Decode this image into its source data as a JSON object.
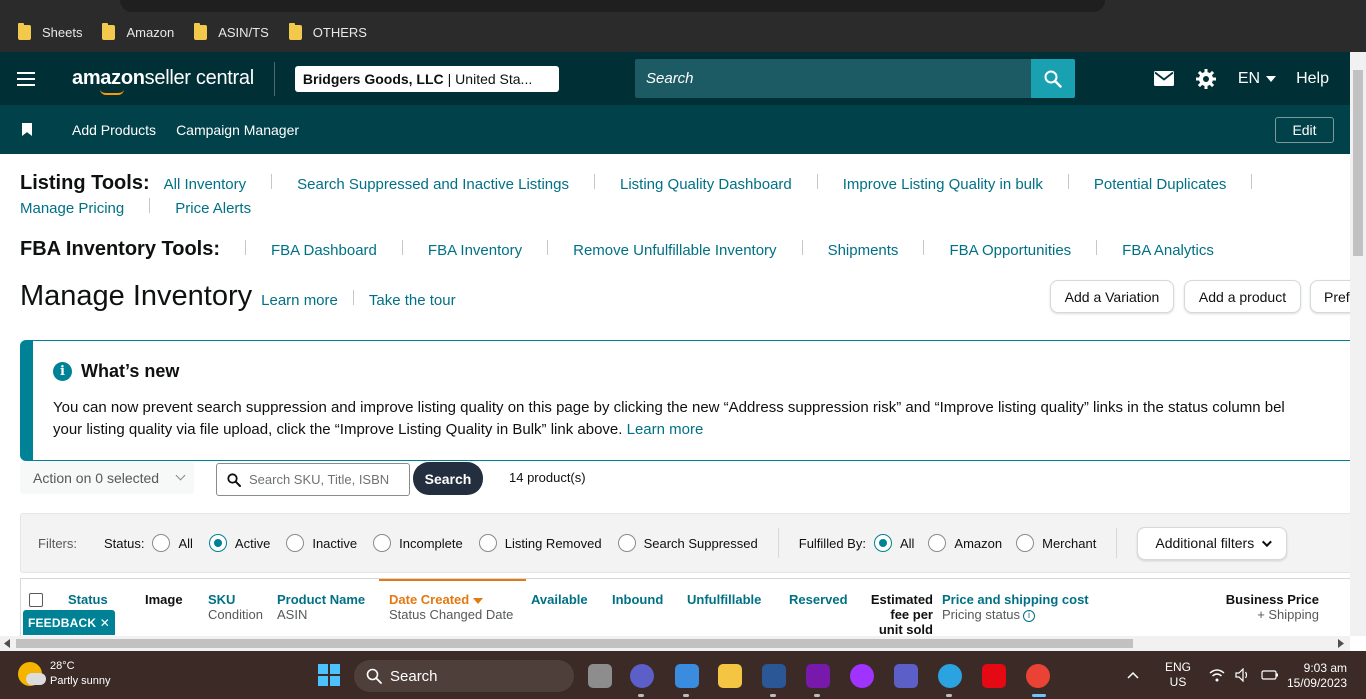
{
  "bookmarks": [
    "Sheets",
    "Amazon",
    "ASIN/TS",
    "OTHERS"
  ],
  "header": {
    "logo_bold": "amazon",
    "logo_rest": " seller central",
    "account_name": "Bridgers Goods, LLC",
    "account_region": "| United Sta...",
    "search_placeholder": "Search",
    "language": "EN",
    "help": "Help"
  },
  "nav": {
    "links": [
      "Add Products",
      "Campaign Manager"
    ],
    "edit": "Edit"
  },
  "listing_tools": {
    "label": "Listing Tools:",
    "links": [
      "All Inventory",
      "Search Suppressed and Inactive Listings",
      "Listing Quality Dashboard",
      "Improve Listing Quality in bulk",
      "Potential Duplicates",
      "Manage Pricing",
      "Price Alerts"
    ]
  },
  "fba_tools": {
    "label": "FBA Inventory Tools:",
    "links": [
      "FBA Dashboard",
      "FBA Inventory",
      "Remove Unfulfillable Inventory",
      "Shipments",
      "FBA Opportunities",
      "FBA Analytics"
    ]
  },
  "page": {
    "title": "Manage Inventory",
    "learn_more": "Learn more",
    "take_tour": "Take the tour",
    "buttons": [
      "Add a Variation",
      "Add a product",
      "Pref"
    ]
  },
  "whats_new": {
    "title": "What’s new",
    "line1": "You can now prevent search suppression and improve listing quality on this page by clicking the new “Address suppression risk” and “Improve listing quality” links in the status column bel",
    "line2_prefix": "your listing quality via file upload, click the “Improve Listing Quality in Bulk” link above.",
    "line2_link": "Learn more"
  },
  "toolbar": {
    "action_select": "Action on 0 selected",
    "search_placeholder": "Search SKU, Title, ISBN",
    "search_button": "Search",
    "product_count": "14 product(s)"
  },
  "filters": {
    "label": "Filters:",
    "status_label": "Status:",
    "status_options": [
      "All",
      "Active",
      "Inactive",
      "Incomplete",
      "Listing Removed",
      "Search Suppressed"
    ],
    "status_selected": "Active",
    "fulfilled_label": "Fulfilled By:",
    "fulfilled_options": [
      "All",
      "Amazon",
      "Merchant"
    ],
    "fulfilled_selected": "All",
    "additional": "Additional filters"
  },
  "table": {
    "columns": [
      {
        "main": "Status",
        "sub": ""
      },
      {
        "main": "Image",
        "sub": ""
      },
      {
        "main": "SKU",
        "sub": "Condition"
      },
      {
        "main": "Product Name",
        "sub": "ASIN"
      },
      {
        "main": "Date Created",
        "sub": "Status Changed Date"
      },
      {
        "main": "Available",
        "sub": ""
      },
      {
        "main": "Inbound",
        "sub": ""
      },
      {
        "main": "Unfulfillable",
        "sub": ""
      },
      {
        "main": "Reserved",
        "sub": ""
      },
      {
        "main": "Estimated fee per unit sold",
        "sub": ""
      },
      {
        "main": "Price and shipping cost",
        "sub": "Pricing status"
      },
      {
        "main": "Business Price",
        "sub": "+ Shipping"
      }
    ],
    "sorted_by": "Date Created"
  },
  "feedback": "FEEDBACK",
  "taskbar": {
    "temperature": "28°C",
    "weather": "Partly sunny",
    "search": "Search",
    "lang_top": "ENG",
    "lang_bottom": "US",
    "time": "9:03 am",
    "date": "15/09/2023"
  },
  "colors": {
    "header_bg": "#002f36",
    "nav_bg": "#00414a",
    "link": "#007185",
    "accent_teal": "#008296",
    "sort_orange": "#e47911"
  }
}
